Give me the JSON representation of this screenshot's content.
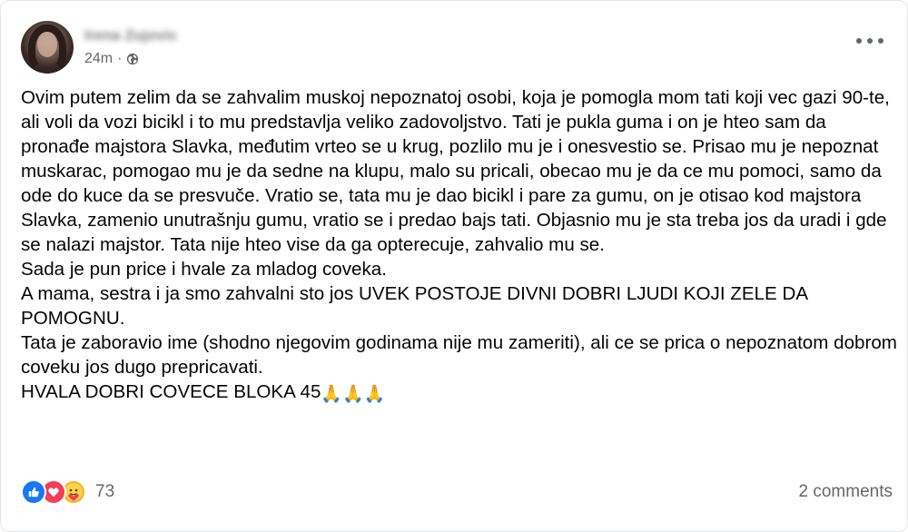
{
  "post": {
    "author_name": "Irena Zujovic",
    "time": "24m",
    "separator": "·",
    "privacy_icon": "globe-icon",
    "more_icon": "more-options-icon",
    "paragraphs": [
      "Ovim putem zelim da se zahvalim muskoj nepoznatoj osobi, koja je pomogla mom tati koji vec gazi 90-te, ali voli da vozi bicikl i to mu predstavlja veliko zadovoljstvo. Tati je pukla guma i on je hteo sam da pronađe majstora Slavka, međutim vrteo se u krug, pozlilo mu je i onesvestio se. Prisao mu je nepoznat muskarac, pomogao mu je da sedne na klupu, malo su pricali, obecao mu je da ce mu pomoci, samo da ode do kuce da se presvuče. Vratio se, tata mu je dao bicikl i pare za gumu, on je otisao kod majstora Slavka, zamenio unutrašnju gumu, vratio se i predao bajs tati. Objasnio mu je sta treba jos da uradi i gde se nalazi majstor. Tata nije hteo vise da ga opterecuje, zahvalio mu se.",
      "Sada je pun price i hvale za mladog coveka.",
      "A mama, sestra i ja smo zahvalni sto jos UVEK POSTOJE DIVNI DOBRI LJUDI KOJI ZELE DA POMOGNU.",
      "Tata je zaboravio ime (shodno njegovim godinama nije mu zameriti), ali ce se prica o nepoznatom dobrom coveku jos dugo prepricavati.",
      "HVALA DOBRI COVECE BLOKA 45"
    ],
    "closing_emoji": "🙏🙏🙏"
  },
  "footer": {
    "reaction_icons": [
      "like-icon",
      "love-icon",
      "care-icon"
    ],
    "reaction_count": "73",
    "comments_label": "2 comments"
  },
  "colors": {
    "like": "#1877f2",
    "love": "#f33e58",
    "care": "#f7b125",
    "secondary_text": "#65676b"
  }
}
